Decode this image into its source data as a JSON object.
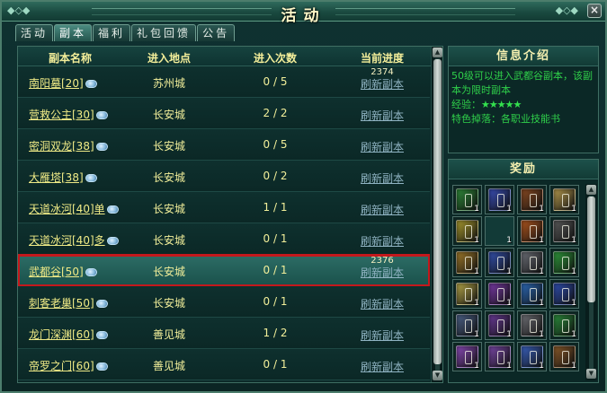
{
  "window": {
    "title": "活动",
    "close_symbol": "×"
  },
  "tabs": [
    {
      "label": "活动",
      "active": false
    },
    {
      "label": "副本",
      "active": true
    },
    {
      "label": "福利",
      "active": false
    },
    {
      "label": "礼包回馈",
      "active": false
    },
    {
      "label": "公告",
      "active": false
    }
  ],
  "table": {
    "headers": {
      "name": "副本名称",
      "location": "进入地点",
      "count": "进入次数",
      "progress": "当前进度"
    },
    "rows": [
      {
        "name": "南阳墓[20]",
        "location": "苏州城",
        "count": "0 / 5",
        "progress": "2374",
        "refresh": "刷新副本"
      },
      {
        "name": "营救公主[30]",
        "location": "长安城",
        "count": "2 / 2",
        "progress": "",
        "refresh": "刷新副本"
      },
      {
        "name": "密洞双龙[38]",
        "location": "长安城",
        "count": "0 / 5",
        "progress": "",
        "refresh": "刷新副本"
      },
      {
        "name": "大雁塔[38]",
        "location": "长安城",
        "count": "0 / 2",
        "progress": "",
        "refresh": "刷新副本"
      },
      {
        "name": "天道冰河[40]单",
        "location": "长安城",
        "count": "1 / 1",
        "progress": "",
        "refresh": "刷新副本"
      },
      {
        "name": "天道冰河[40]多",
        "location": "长安城",
        "count": "0 / 1",
        "progress": "",
        "refresh": "刷新副本"
      },
      {
        "name": "武都谷[50]",
        "location": "长安城",
        "count": "0 / 1",
        "progress": "2376",
        "refresh": "刷新副本"
      },
      {
        "name": "刺客老巢[50]",
        "location": "长安城",
        "count": "0 / 1",
        "progress": "",
        "refresh": "刷新副本"
      },
      {
        "name": "龙门深渊[60]",
        "location": "善见城",
        "count": "1 / 2",
        "progress": "",
        "refresh": "刷新副本"
      },
      {
        "name": "帝罗之门[60]",
        "location": "善见城",
        "count": "0 / 1",
        "progress": "",
        "refresh": "刷新副本"
      }
    ]
  },
  "info": {
    "title": "信息介绍",
    "line1": "50级可以进入武都谷副本，该副本为限时副本",
    "exp_label": "经验：",
    "exp_stars": "★★★★★",
    "drop_label": "特色掉落：",
    "drop_value": "各职业技能书"
  },
  "rewards": {
    "title": "奖励",
    "items": [
      {
        "icon": "green-skill-book-icon",
        "color": "#2f8a3a",
        "qty": "1"
      },
      {
        "icon": "blue-skill-book-icon",
        "color": "#3a4fb8",
        "qty": "1"
      },
      {
        "icon": "brown-skill-book-icon",
        "color": "#8a4a22",
        "qty": "1"
      },
      {
        "icon": "tan-skill-book-icon",
        "color": "#b69a4e",
        "qty": "1"
      },
      {
        "icon": "yellow-skill-book-icon",
        "color": "#a99a2e",
        "qty": "1"
      },
      {
        "icon": "empty-slot",
        "color": "",
        "qty": "1"
      },
      {
        "icon": "orange-skill-book-icon",
        "color": "#b0561e",
        "qty": "1"
      },
      {
        "icon": "yin-yang-book-icon",
        "color": "#5a5a5a",
        "qty": "1"
      },
      {
        "icon": "gold-skill-book-icon",
        "color": "#a07a2a",
        "qty": "1"
      },
      {
        "icon": "blue-skill-book-icon",
        "color": "#3552b0",
        "qty": "1"
      },
      {
        "icon": "gray-skill-book-icon",
        "color": "#6d7078",
        "qty": "1"
      },
      {
        "icon": "green-skill-book-icon",
        "color": "#2f9a3c",
        "qty": "1"
      },
      {
        "icon": "yellow-skill-book-icon",
        "color": "#b5a648",
        "qty": "1"
      },
      {
        "icon": "purple-skill-book-icon",
        "color": "#7a3aa8",
        "qty": "1"
      },
      {
        "icon": "blue-skill-book-icon",
        "color": "#2c6ab8",
        "qty": "1"
      },
      {
        "icon": "blue-skill-book-icon",
        "color": "#2f4eb0",
        "qty": "1"
      },
      {
        "icon": "blue-gray-skill-book-icon",
        "color": "#4c6288",
        "qty": "1"
      },
      {
        "icon": "purple-skill-book-icon",
        "color": "#6a3a98",
        "qty": "1"
      },
      {
        "icon": "gray-skill-book-icon",
        "color": "#6f7076",
        "qty": "1"
      },
      {
        "icon": "green-skill-book-icon",
        "color": "#2b8c3c",
        "qty": "1"
      },
      {
        "icon": "purple-skill-book-icon",
        "color": "#8a4ab8",
        "qty": "1"
      },
      {
        "icon": "purple-skill-book-icon",
        "color": "#7a48a8",
        "qty": "1"
      },
      {
        "icon": "blue-skill-book-icon",
        "color": "#3a62c0",
        "qty": "1"
      },
      {
        "icon": "brown-skill-book-icon",
        "color": "#8a5a2a",
        "qty": "1"
      }
    ]
  }
}
